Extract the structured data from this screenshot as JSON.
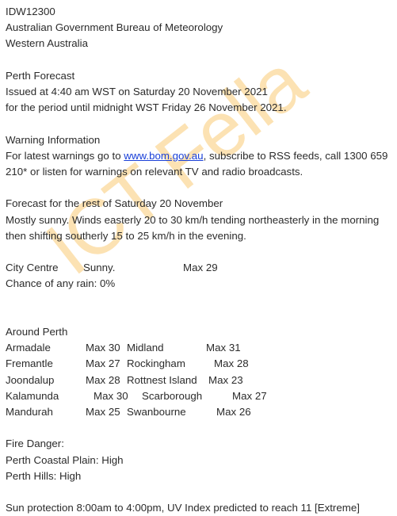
{
  "watermark": {
    "text": "ICT Fella",
    "color": "#fce2b3"
  },
  "colors": {
    "text": "#2b2b2b",
    "link": "#1a40d8",
    "background": "#ffffff"
  },
  "header": {
    "product_id": "IDW12300",
    "agency": "Australian Government Bureau of Meteorology",
    "region": "Western Australia"
  },
  "forecast_meta": {
    "title": "Perth Forecast",
    "issued": "Issued at 4:40 am WST on Saturday 20 November 2021",
    "period": "for the period until midnight WST Friday 26 November 2021."
  },
  "warning": {
    "heading": "Warning Information",
    "line1_before_link": "For latest warnings go to ",
    "link_text": "www.bom.gov.au",
    "line1_after_link": ", subscribe to RSS feeds, call 1300 659",
    "line2": "210* or listen for warnings on relevant TV and radio broadcasts."
  },
  "today_forecast": {
    "heading": "Forecast for the rest of Saturday 20 November",
    "line1": "Mostly sunny. Winds easterly 20 to 30 km/h tending northeasterly in the morning",
    "line2": "then shifting southerly 15 to 25 km/h in the evening."
  },
  "city_centre": {
    "location": "City Centre",
    "condition": "Sunny.",
    "max": "Max 29",
    "rain_chance": "Chance of any rain: 0%"
  },
  "around_perth": {
    "heading": "Around Perth",
    "rows": [
      {
        "name": "Armadale",
        "max": "Max 30",
        "name2": "Midland",
        "max2": "Max 31"
      },
      {
        "name": "Fremantle",
        "max": "Max 27",
        "name2": "Rockingham",
        "max2": "Max 28"
      },
      {
        "name": "Joondalup",
        "max": "Max 28",
        "name2": "Rottnest Island",
        "max2": "Max 23"
      },
      {
        "name": "Kalamunda",
        "max": "Max 30",
        "name2": "Scarborough",
        "max2": "Max 27"
      },
      {
        "name": "Mandurah",
        "max": "Max 25",
        "name2": "Swanbourne",
        "max2": "Max 26"
      }
    ]
  },
  "fire_danger": {
    "heading": "Fire Danger:",
    "coastal_plain": "Perth Coastal Plain: High",
    "hills": "Perth Hills: High"
  },
  "sun_protection": {
    "text": "Sun protection 8:00am to 4:00pm, UV Index predicted to reach 11 [Extreme]"
  }
}
